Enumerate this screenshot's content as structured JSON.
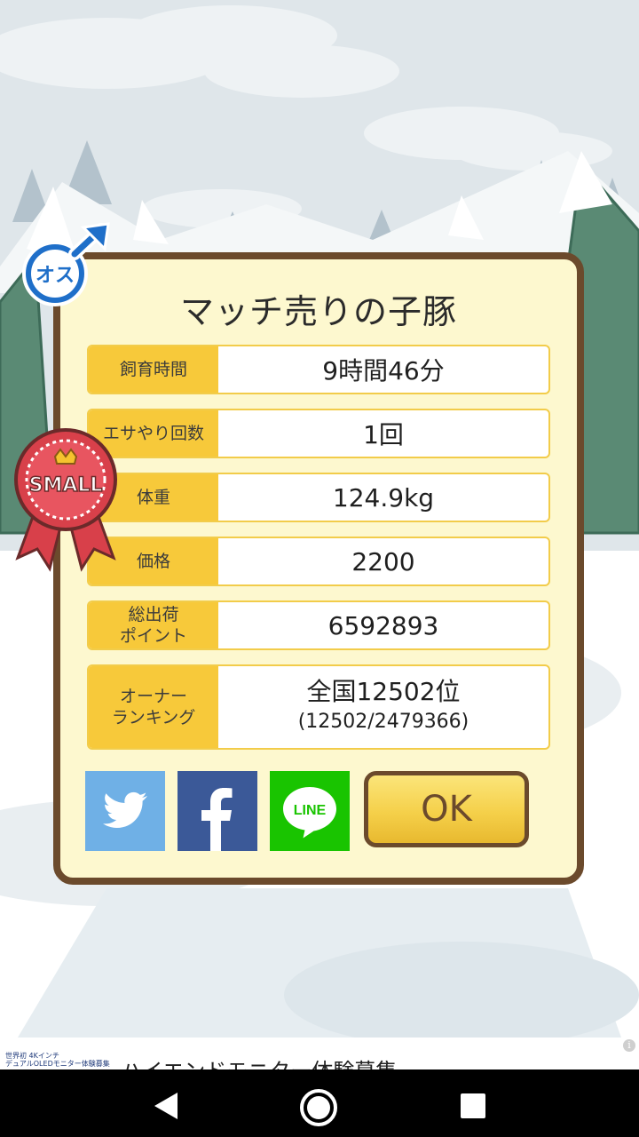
{
  "dialog": {
    "title": "マッチ売りの子豚",
    "rows": [
      {
        "label": "飼育時間",
        "value": "9時間46分"
      },
      {
        "label": "エサやり回数",
        "value": "1回"
      },
      {
        "label": "体重",
        "value": "124.9kg"
      },
      {
        "label": "価格",
        "value": "2200"
      },
      {
        "label": "総出荷\nポイント",
        "value": "6592893"
      },
      {
        "label": "オーナー\nランキング",
        "value": "全国12502位",
        "sub": "(12502/2479366)"
      }
    ],
    "ok_label": "OK",
    "share": {
      "twitter": "twitter-icon",
      "facebook": "facebook-icon",
      "line_label": "LINE"
    }
  },
  "badges": {
    "gender_text": "オス",
    "size_text": "SMALL"
  },
  "ad": {
    "small_text": "世界初 4Kインチ\nデュアルOLEDモニター体験募集",
    "headline": "ハイエンドモニター体験募集",
    "info": "i"
  },
  "colors": {
    "frame": "#6b4a2c",
    "panel": "#fdf8cf",
    "label_bg": "#f7c93a",
    "twitter": "#6fb0e6",
    "facebook": "#3b5998",
    "line": "#19c400"
  }
}
